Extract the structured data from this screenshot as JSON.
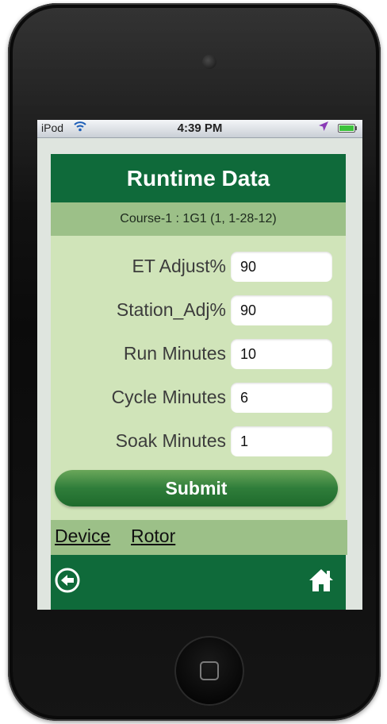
{
  "status_bar": {
    "carrier": "iPod",
    "time": "4:39 PM",
    "wifi_icon": "wifi-icon",
    "location_icon": "location-arrow-icon",
    "battery_icon": "battery-icon"
  },
  "header": {
    "title": "Runtime Data"
  },
  "subheader": {
    "text": "Course-1 : 1G1 (1, 1-28-12)"
  },
  "form": {
    "fields": [
      {
        "label": "ET Adjust%",
        "value": "90"
      },
      {
        "label": "Station_Adj%",
        "value": "90"
      },
      {
        "label": "Run Minutes",
        "value": "10"
      },
      {
        "label": "Cycle Minutes",
        "value": "6"
      },
      {
        "label": "Soak Minutes",
        "value": "1"
      }
    ],
    "submit_label": "Submit"
  },
  "links": [
    {
      "label": "Device"
    },
    {
      "label": "Rotor"
    }
  ],
  "footer": {
    "back_icon": "back-arrow-icon",
    "home_icon": "home-icon"
  },
  "colors": {
    "header_green": "#0f6a3a",
    "subheader_green": "#9cc088",
    "content_green": "#d0e4b9",
    "button_green": "#2f7d3a"
  }
}
